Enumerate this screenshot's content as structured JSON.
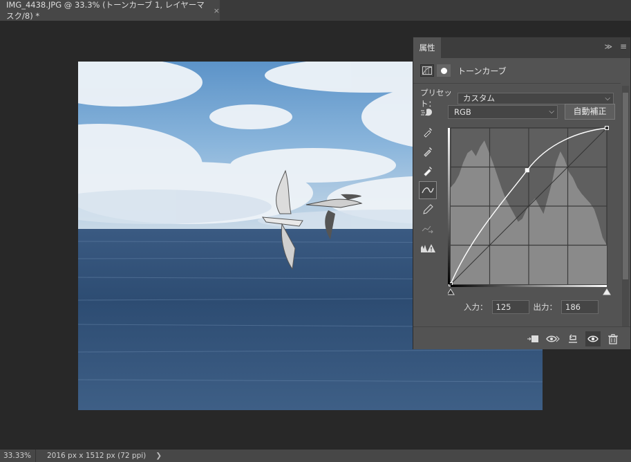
{
  "document_tab": {
    "title": "IMG_4438.JPG @ 33.3% (トーンカーブ 1, レイヤーマスク/8) *",
    "close": "×"
  },
  "status": {
    "zoom": "33.33%",
    "info": "2016 px x 1512 px (72 ppi)",
    "arrow": "❯"
  },
  "panel": {
    "tab_label": "属性",
    "collapse": "≫",
    "menu": "≡",
    "adjustment_title": "トーンカーブ",
    "preset_label": "プリセット：",
    "preset_value": "カスタム",
    "channel_value": "RGB",
    "auto_button": "自動補正",
    "input_label": "入力：",
    "input_value": "125",
    "output_label": "出力：",
    "output_value": "186"
  },
  "curve": {
    "points": [
      [
        0,
        0
      ],
      [
        125,
        186
      ],
      [
        255,
        255
      ]
    ],
    "colors": {
      "curve": "#ffffff",
      "grid": "#3a3a3a",
      "histogram": "#8a8a8a",
      "graph_bg": "#5f5f5f"
    }
  }
}
